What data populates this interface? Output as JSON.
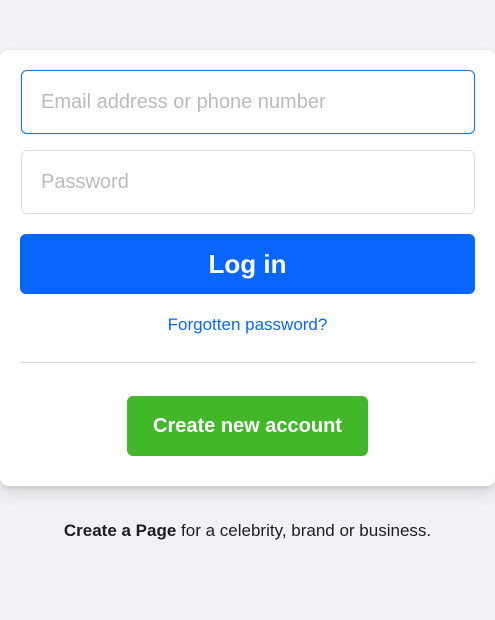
{
  "login_form": {
    "email_placeholder": "Email address or phone number",
    "email_value": "",
    "password_placeholder": "Password",
    "password_value": "",
    "login_label": "Log in",
    "forgot_label": "Forgotten password?",
    "create_account_label": "Create new account"
  },
  "footer": {
    "create_page_link": "Create a Page",
    "create_page_text": " for a celebrity, brand or business."
  },
  "colors": {
    "primary_blue": "#0866ff",
    "create_green": "#42b72a",
    "background": "#f0f2f5"
  }
}
